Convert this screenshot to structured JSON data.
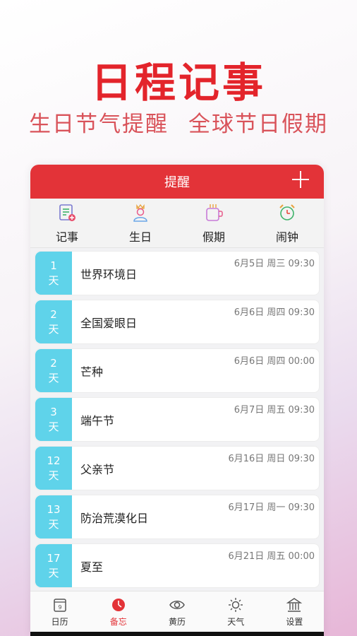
{
  "promo": {
    "headline": "日程记事",
    "sub1": "生日节气提醒",
    "sub2": "全球节日假期"
  },
  "header": {
    "title": "提醒"
  },
  "categories": [
    {
      "label": "记事",
      "icon": "note-icon"
    },
    {
      "label": "生日",
      "icon": "birthday-person-icon"
    },
    {
      "label": "假期",
      "icon": "holiday-cup-icon"
    },
    {
      "label": "闹钟",
      "icon": "alarm-clock-icon"
    }
  ],
  "reminders": [
    {
      "num": "1",
      "unit": "天",
      "name": "世界环境日",
      "date": "6月5日 周三 09:30"
    },
    {
      "num": "2",
      "unit": "天",
      "name": "全国爱眼日",
      "date": "6月6日 周四 09:30"
    },
    {
      "num": "2",
      "unit": "天",
      "name": "芒种",
      "date": "6月6日 周四 00:00"
    },
    {
      "num": "3",
      "unit": "天",
      "name": "端午节",
      "date": "6月7日 周五 09:30"
    },
    {
      "num": "12",
      "unit": "天",
      "name": "父亲节",
      "date": "6月16日 周日 09:30"
    },
    {
      "num": "13",
      "unit": "天",
      "name": "防治荒漠化日",
      "date": "6月17日 周一 09:30"
    },
    {
      "num": "17",
      "unit": "天",
      "name": "夏至",
      "date": "6月21日 周五 00:00"
    }
  ],
  "tabs": [
    {
      "label": "日历",
      "icon": "calendar-icon"
    },
    {
      "label": "备忘",
      "icon": "memo-clock-icon"
    },
    {
      "label": "黄历",
      "icon": "eye-icon"
    },
    {
      "label": "天气",
      "icon": "sun-icon"
    },
    {
      "label": "设置",
      "icon": "settings-building-icon"
    }
  ],
  "colors": {
    "brand_red": "#e33338",
    "days_cyan": "#5fd3ea",
    "headline_red": "#e3242b"
  }
}
